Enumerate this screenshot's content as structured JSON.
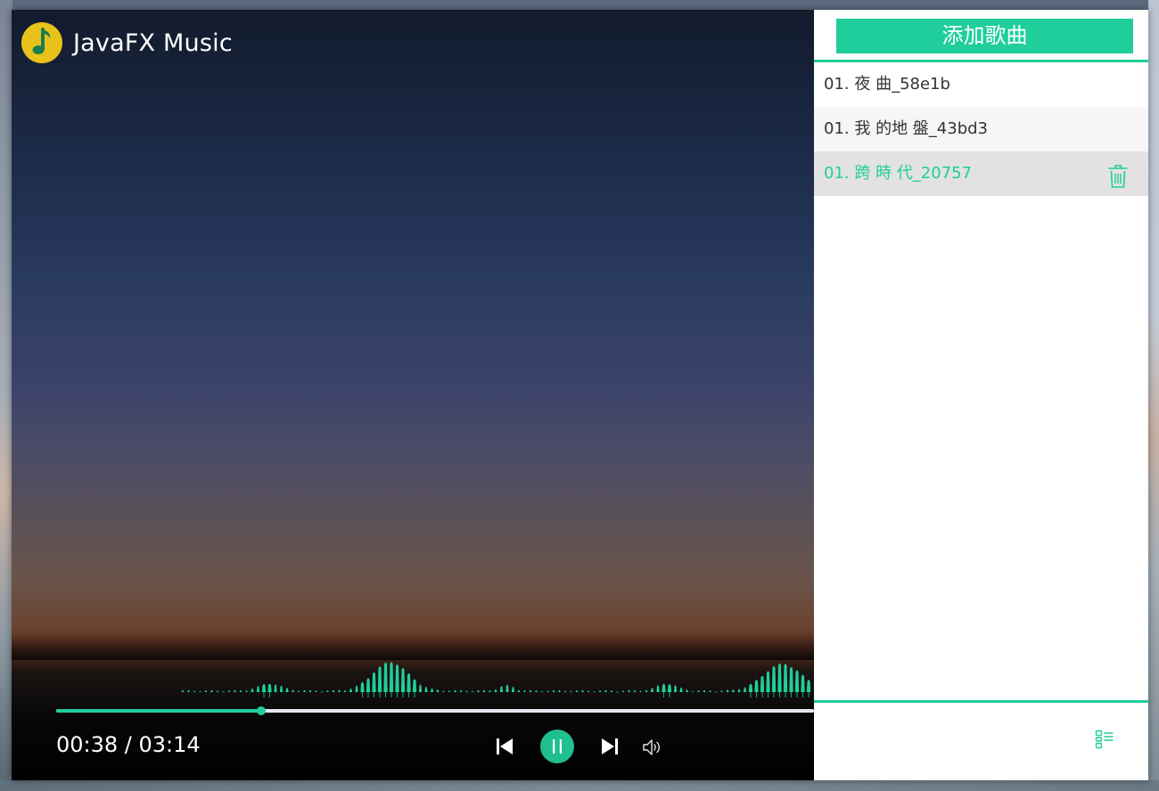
{
  "app": {
    "title": "JavaFX Music",
    "logo_icon": "music-note-icon",
    "accent_color": "#1fce9b"
  },
  "player": {
    "elapsed": "00:38",
    "total": "03:14",
    "time_display": "00:38 / 03:14",
    "progress_fraction": 0.27,
    "state": "playing",
    "controls": {
      "prev_icon": "skip-previous-icon",
      "play_pause_icon": "pause-icon",
      "next_icon": "skip-next-icon",
      "volume_icon": "volume-icon"
    }
  },
  "playlist": {
    "add_button_label": "添加歌曲",
    "songs": [
      {
        "label": "01. 夜 曲_58e1b",
        "active": false
      },
      {
        "label": "01. 我 的地 盤_43bd3",
        "active": false
      },
      {
        "label": "01. 跨 時 代_20757",
        "active": true
      }
    ],
    "delete_icon": "trash-icon",
    "toggle_icon": "playlist-icon"
  }
}
